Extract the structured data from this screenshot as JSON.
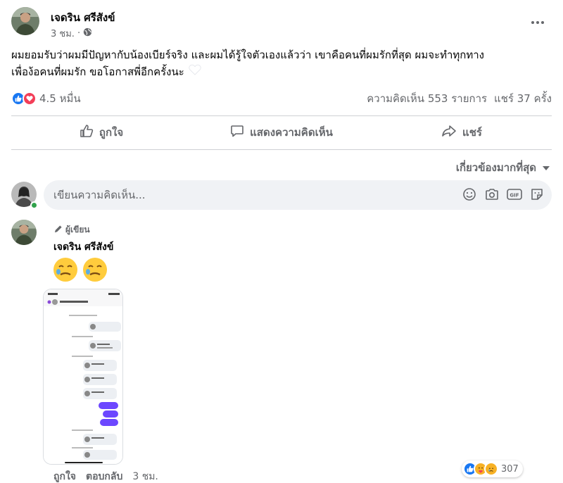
{
  "post": {
    "author": "เจดริน ศรีสังข์",
    "time": "3 ชม.",
    "text_line1": "ผมยอมรับว่าผมมีปัญหากับน้องเบียร์จริง และผมได้รู้ใจตัวเองแล้วว่า เขาคือคนที่ผมรักที่สุด ผมจะทำทุกทาง",
    "text_line2": "เพื่อง้อคนที่ผมรัก ขอโอกาสพี่อีกครั้งนะ",
    "reaction_count": "4.5 หมื่น",
    "comments_count": "ความคิดเห็น 553 รายการ",
    "shares_count": "แชร์ 37 ครั้ง"
  },
  "actions": {
    "like": "ถูกใจ",
    "comment": "แสดงความคิดเห็น",
    "share": "แชร์"
  },
  "sort": {
    "label": "เกี่ยวข้องมากที่สุด"
  },
  "composer": {
    "placeholder": "เขียนความคิดเห็น..."
  },
  "comment": {
    "badge": "ผู้เขียน",
    "author": "เจดริน ศรีสังข์",
    "emoji": "🥲🥲",
    "like": "ถูกใจ",
    "reply": "ตอบกลับ",
    "time": "3 ชม.",
    "reaction_count": "307"
  },
  "icons": {
    "globe": "globe-icon",
    "more": "more-options-icon",
    "like": "thumbs-up-icon",
    "comment": "comment-bubble-icon",
    "share": "share-arrow-icon",
    "emoji": "smiley-icon",
    "camera": "camera-icon",
    "gif": "gif-icon",
    "sticker": "sticker-icon",
    "pencil": "pencil-icon"
  },
  "colors": {
    "like_blue": "#1877f2",
    "love_red": "#f33e58",
    "secondary_text": "#65676b",
    "online_green": "#31a24c",
    "input_bg": "#f0f2f5"
  }
}
